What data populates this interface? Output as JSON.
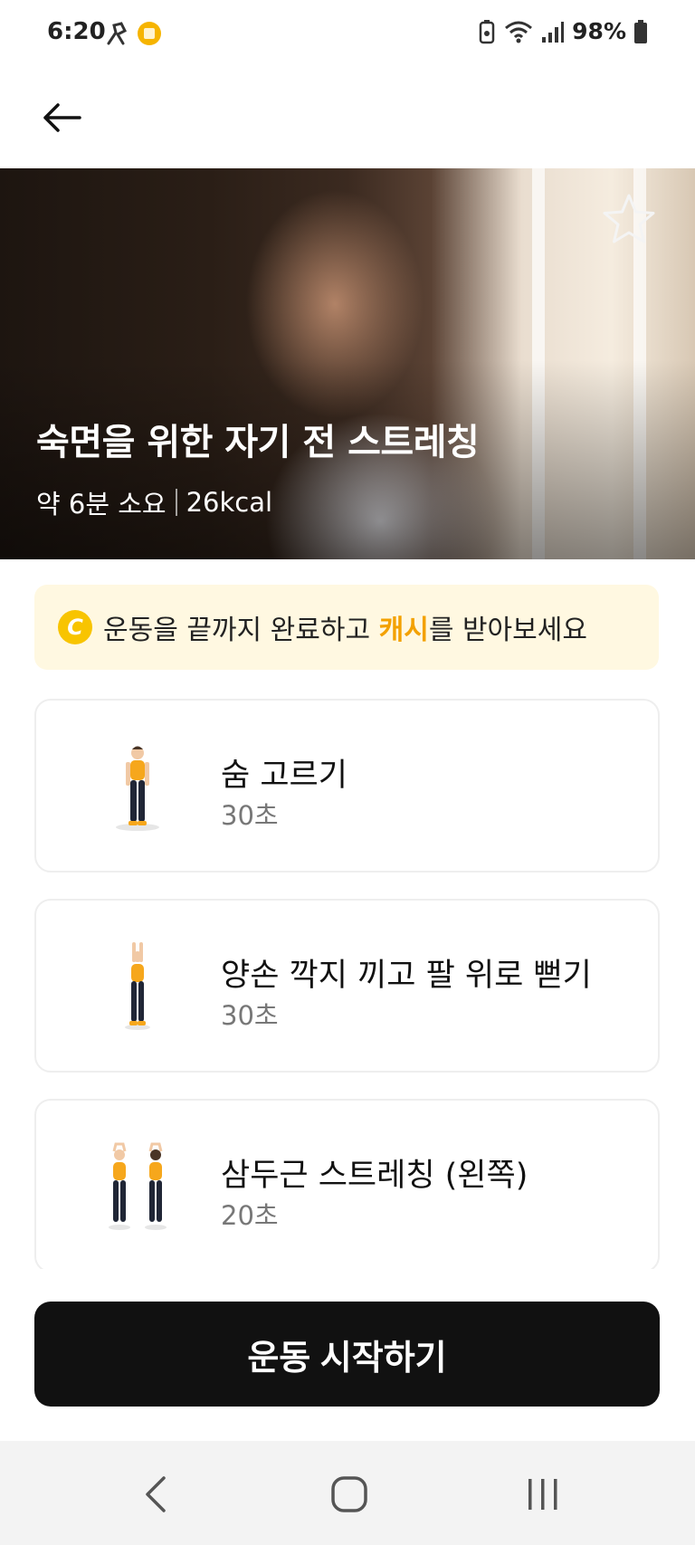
{
  "status_bar": {
    "time": "6:20",
    "battery": "98%"
  },
  "header": {
    "back_icon": "arrow-left-icon"
  },
  "hero": {
    "title": "숙면을 위한 자기 전 스트레칭",
    "duration": "약 6분 소요",
    "calories": "26kcal",
    "favorite_icon": "star-outline-icon"
  },
  "cash_banner": {
    "coin_symbol": "C",
    "text_before": "운동을 끝까지 완료하고 ",
    "highlight": "캐시",
    "text_after": "를 받아보세요",
    "highlight_color": "#f3a100"
  },
  "exercises": [
    {
      "name": "숨 고르기",
      "duration": "30초"
    },
    {
      "name": "양손 깍지 끼고 팔 위로 뻗기",
      "duration": "30초"
    },
    {
      "name": "삼두근 스트레칭 (왼쪽)",
      "duration": "20초"
    }
  ],
  "start_button": {
    "label": "운동 시작하기"
  },
  "nav": {
    "back_icon": "nav-back-icon",
    "home_icon": "nav-home-icon",
    "recents_icon": "nav-recents-icon"
  },
  "colors": {
    "accent": "#f3a100",
    "primary_button": "#111111",
    "banner_bg": "#fff8e1"
  }
}
